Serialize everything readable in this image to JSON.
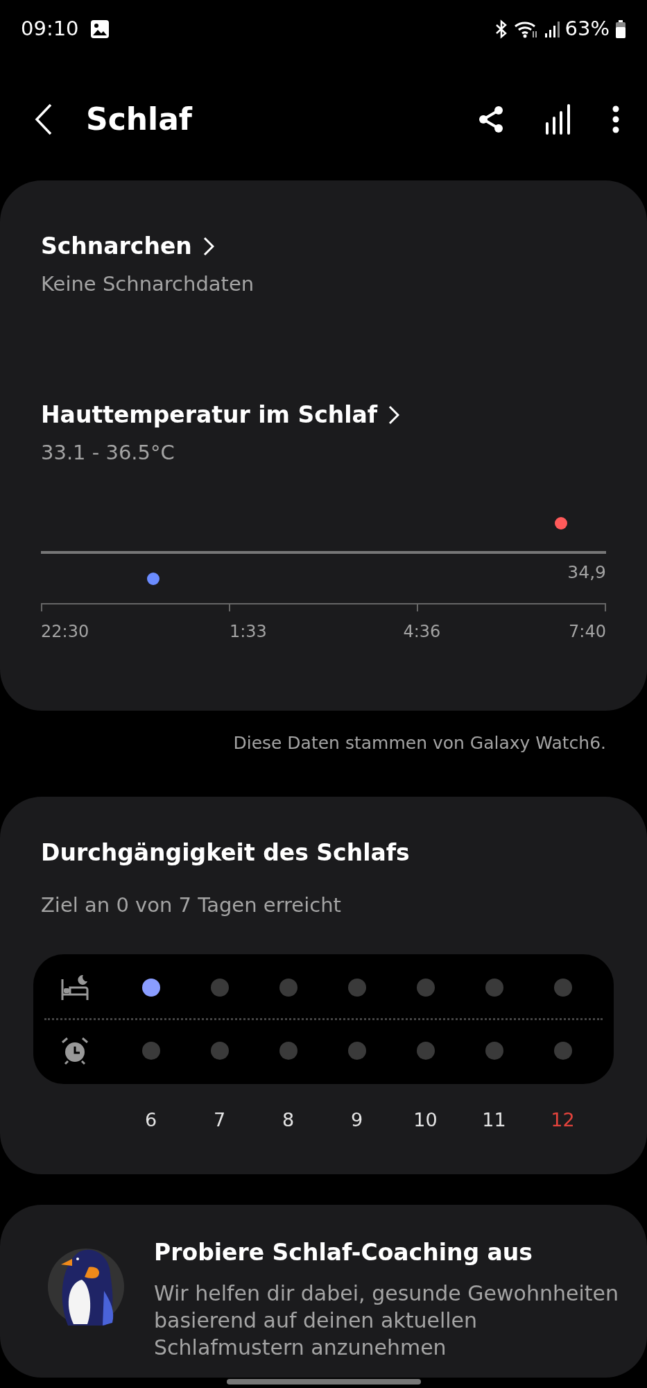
{
  "status_bar": {
    "time": "09:10",
    "battery": "63%"
  },
  "header": {
    "title": "Schlaf"
  },
  "snoring": {
    "title": "Schnarchen",
    "subtitle": "Keine Schnarchdaten"
  },
  "skin_temperature": {
    "title": "Hauttemperatur im Schlaf",
    "range": "33.1 - 36.5°C",
    "average_label": "34,9",
    "x_labels": [
      "22:30",
      "1:33",
      "4:36",
      "7:40"
    ],
    "points": [
      {
        "kind": "min",
        "color": "#6b8cff"
      },
      {
        "kind": "max",
        "color": "#ff5a5a"
      }
    ]
  },
  "source_note": "Diese Daten stammen von Galaxy Watch6.",
  "consistency": {
    "title": "Durchgängigkeit des Schlafs",
    "subtitle": "Ziel an 0 von 7 Tagen erreicht",
    "days": [
      {
        "label": "6",
        "bedtime_met": true,
        "wakeup_met": false,
        "weekend": false
      },
      {
        "label": "7",
        "bedtime_met": false,
        "wakeup_met": false,
        "weekend": false
      },
      {
        "label": "8",
        "bedtime_met": false,
        "wakeup_met": false,
        "weekend": false
      },
      {
        "label": "9",
        "bedtime_met": false,
        "wakeup_met": false,
        "weekend": false
      },
      {
        "label": "10",
        "bedtime_met": false,
        "wakeup_met": false,
        "weekend": false
      },
      {
        "label": "11",
        "bedtime_met": false,
        "wakeup_met": false,
        "weekend": false
      },
      {
        "label": "12",
        "bedtime_met": false,
        "wakeup_met": false,
        "weekend": true
      }
    ]
  },
  "coaching": {
    "title": "Probiere Schlaf-Coaching aus",
    "text": "Wir helfen dir dabei, gesunde Gewohnheiten basierend auf deinen aktuellen Schlafmustern anzunehmen"
  }
}
